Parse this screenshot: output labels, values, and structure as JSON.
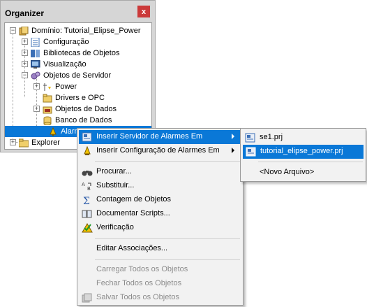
{
  "organizer": {
    "title": "Organizer",
    "close_label": "x",
    "tree": [
      {
        "label": "Domínio: Tutorial_Elipse_Power",
        "icon": "domain-icon"
      },
      {
        "label": "Configuração",
        "icon": "config-icon"
      },
      {
        "label": "Bibliotecas de Objetos",
        "icon": "library-icon"
      },
      {
        "label": "Visualização",
        "icon": "visualization-icon"
      },
      {
        "label": "Objetos de Servidor",
        "icon": "server-objects-icon"
      },
      {
        "label": "Power",
        "icon": "power-icon"
      },
      {
        "label": "Drivers e OPC",
        "icon": "drivers-icon"
      },
      {
        "label": "Objetos de Dados",
        "icon": "data-objects-icon"
      },
      {
        "label": "Banco de Dados",
        "icon": "database-icon"
      },
      {
        "label": "Alarmes",
        "icon": "alarms-icon"
      },
      {
        "label": "Explorer",
        "icon": "explorer-icon"
      }
    ]
  },
  "context_menu": {
    "items": [
      {
        "label": "Inserir Servidor de Alarmes Em",
        "icon": "insert-server-icon",
        "submenu": true,
        "highlighted": true
      },
      {
        "label": "Inserir Configuração de Alarmes Em",
        "icon": "alarm-config-icon",
        "submenu": true
      },
      {
        "label": "Procurar...",
        "icon": "binoculars-icon"
      },
      {
        "label": "Substituir...",
        "icon": "replace-icon"
      },
      {
        "label": "Contagem de Objetos",
        "icon": "sigma-icon"
      },
      {
        "label": "Documentar Scripts...",
        "icon": "document-scripts-icon"
      },
      {
        "label": "Verificação",
        "icon": "check-icon"
      },
      {
        "label": "Editar Associações..."
      },
      {
        "label": "Carregar Todos os Objetos",
        "disabled": true
      },
      {
        "label": "Fechar Todos os Objetos",
        "disabled": true
      },
      {
        "label": "Salvar Todos os Objetos",
        "icon": "save-all-icon",
        "disabled": true
      }
    ]
  },
  "submenu": {
    "items": [
      {
        "label": "se1.prj",
        "icon": "project-icon"
      },
      {
        "label": "tutorial_elipse_power.prj",
        "icon": "project-icon",
        "highlighted": true
      },
      {
        "label": "<Novo Arquivo>"
      }
    ]
  },
  "colors": {
    "selection": "#0a78d7",
    "close_button": "#cb3a3a",
    "menu_bg": "#f2f2f2",
    "panel_bg": "#d6d6d6"
  }
}
